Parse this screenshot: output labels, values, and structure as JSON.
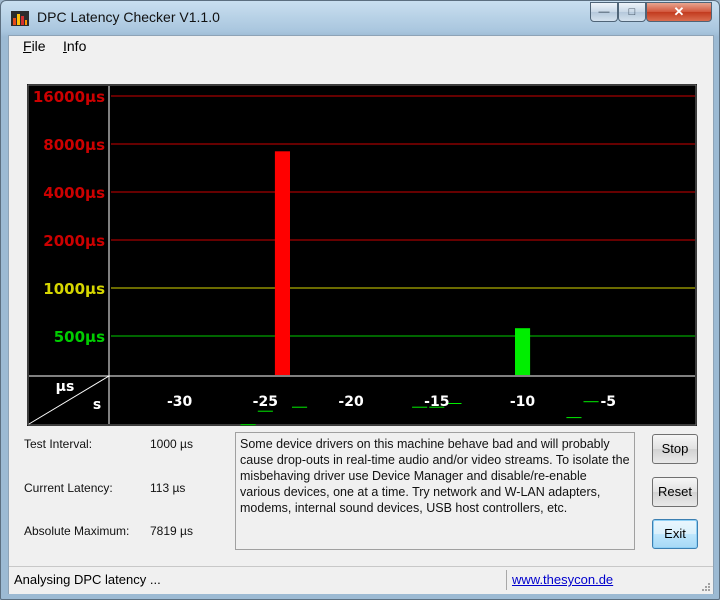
{
  "window": {
    "title": "DPC Latency Checker V1.1.0"
  },
  "titlebar_buttons": {
    "minimize": "—",
    "maximize": "□",
    "close": "✕"
  },
  "menu": {
    "items": [
      {
        "underline": "F",
        "rest": "ile"
      },
      {
        "underline": "I",
        "rest": "nfo"
      }
    ]
  },
  "chart_data": {
    "type": "bar",
    "y_scale": "log",
    "y_ticks": [
      {
        "label": "16000µs",
        "value": 16000,
        "color": "#cc0000"
      },
      {
        "label": "8000µs",
        "value": 8000,
        "color": "#cc0000"
      },
      {
        "label": "4000µs",
        "value": 4000,
        "color": "#cc0000"
      },
      {
        "label": "2000µs",
        "value": 2000,
        "color": "#cc0000"
      },
      {
        "label": "1000µs",
        "value": 1000,
        "color": "#d6d600"
      },
      {
        "label": "500µs",
        "value": 500,
        "color": "#00cc00"
      }
    ],
    "x_ticks": [
      "-30",
      "-25",
      "-20",
      "-15",
      "-10",
      "-5"
    ],
    "x_tick_values": [
      -30,
      -25,
      -20,
      -15,
      -10,
      -5
    ],
    "x_range": [
      -34,
      0
    ],
    "axis_corner": {
      "y_unit": "µs",
      "x_unit": "s"
    },
    "bar_colors": {
      "ok": "#00ee00",
      "bad": "#ff0000"
    },
    "bars": [
      {
        "x": -33,
        "value": 110
      },
      {
        "x": -32,
        "value": 112
      },
      {
        "x": -31,
        "value": 110
      },
      {
        "x": -30,
        "value": 106
      },
      {
        "x": -29,
        "value": 115
      },
      {
        "x": -28,
        "value": 107
      },
      {
        "x": -27,
        "value": 103
      },
      {
        "x": -26,
        "value": 140
      },
      {
        "x": -25,
        "value": 170
      },
      {
        "x": -24,
        "value": 7200,
        "alert": true
      },
      {
        "x": -23,
        "value": 180
      },
      {
        "x": -22,
        "value": 103
      },
      {
        "x": -21,
        "value": 103
      },
      {
        "x": -20,
        "value": 103
      },
      {
        "x": -19,
        "value": 103
      },
      {
        "x": -18,
        "value": 100
      },
      {
        "x": -17,
        "value": 103
      },
      {
        "x": -16,
        "value": 180
      },
      {
        "x": -15,
        "value": 180
      },
      {
        "x": -14,
        "value": 190
      },
      {
        "x": -13,
        "value": 103
      },
      {
        "x": -12,
        "value": 103
      },
      {
        "x": -11,
        "value": 100
      },
      {
        "x": -10,
        "value": 560
      },
      {
        "x": -9,
        "value": 103
      },
      {
        "x": -8,
        "value": 110
      },
      {
        "x": -7,
        "value": 155
      },
      {
        "x": -6,
        "value": 195
      },
      {
        "x": -5,
        "value": 100
      },
      {
        "x": -4,
        "value": 115
      },
      {
        "x": -3,
        "value": 100
      },
      {
        "x": -2,
        "value": 102
      },
      {
        "x": -1,
        "value": 105
      }
    ]
  },
  "stats": {
    "test_interval": {
      "label": "Test Interval:",
      "value": "1000 µs"
    },
    "current_latency": {
      "label": "Current Latency:",
      "value": "113 µs"
    },
    "absolute_maximum": {
      "label": "Absolute Maximum:",
      "value": "7819 µs"
    }
  },
  "message": "Some device drivers on this machine behave bad and will probably cause drop-outs in real-time audio and/or video streams. To isolate the misbehaving driver use Device Manager and disable/re-enable various devices, one at a time. Try network and W-LAN adapters, modems, internal sound devices, USB host controllers, etc.",
  "buttons": {
    "stop": "Stop",
    "reset": "Reset",
    "exit": "Exit"
  },
  "status": {
    "text": "Analysing DPC latency ...",
    "link": "www.thesycon.de"
  }
}
